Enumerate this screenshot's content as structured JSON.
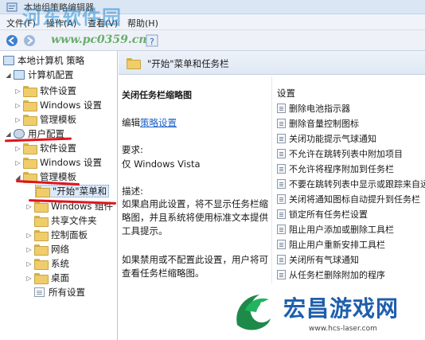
{
  "window": {
    "title": "本地组策略编辑器",
    "menus": [
      "文件(F)",
      "操作(A)",
      "查看(V)",
      "帮助(H)"
    ]
  },
  "watermark": {
    "top_text": "河东软件园",
    "top_url": "www.pc0359.cn",
    "bottom_name": "宏昌游戏网",
    "bottom_url": "www.hcs-laser.com"
  },
  "tree": {
    "root": "本地计算机 策略",
    "computer_config": "计算机配置",
    "cc_software": "软件设置",
    "cc_windows": "Windows 设置",
    "cc_admin": "管理模板",
    "user_config": "用户配置",
    "uc_software": "软件设置",
    "uc_windows": "Windows 设置",
    "uc_admin": "管理模板",
    "start_menu": "\"开始\"菜单和",
    "windows_components": "Windows 组件",
    "shared_folders": "共享文件夹",
    "control_panel": "控制面板",
    "network": "网络",
    "system": "系统",
    "desktop": "桌面",
    "all_settings": "所有设置"
  },
  "header": {
    "title": "\"开始\"菜单和任务栏"
  },
  "description": {
    "policy_title": "关闭任务栏缩略图",
    "edit_prefix": "编辑",
    "edit_link": "策略设置",
    "requirements_label": "要求:",
    "requirements_value": "仅 Windows Vista",
    "desc_label": "描述:",
    "desc_text": "如果启用此设置，将不显示任务栏缩略图，并且系统将使用标准文本提供工具提示。",
    "desc_text2": "如果禁用或不配置此设置，用户将可查看任务栏缩略图。"
  },
  "list": {
    "column_header": "设置",
    "items": [
      "删除电池指示器",
      "删除音量控制图标",
      "关闭功能提示气球通知",
      "不允许在跳转列表中附加项目",
      "不允许将程序附加到任务栏",
      "不要在跳转列表中显示或跟踪来自远",
      "关闭将通知图标自动提升到任务栏",
      "锁定所有任务栏设置",
      "阻止用户添加或删除工具栏",
      "阻止用户重新安排工具栏",
      "关闭所有气球通知",
      "从任务栏删除附加的程序"
    ]
  },
  "colors": {
    "annotation": "#e0141c",
    "link": "#1f63c7",
    "watermark_blue": "#1e5fae"
  }
}
